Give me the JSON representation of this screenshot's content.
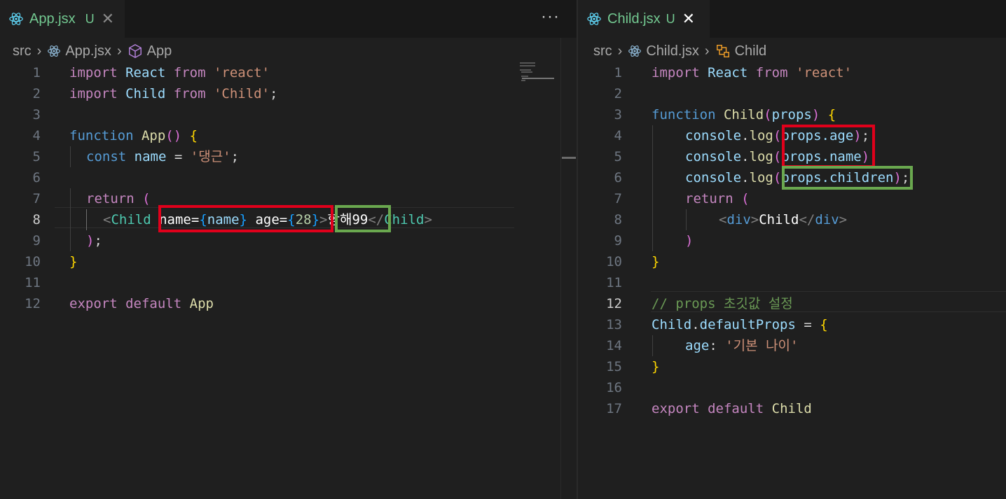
{
  "left_editor": {
    "tab": {
      "filename": "App.jsx",
      "status": "U",
      "close": "✕"
    },
    "more_actions": "···",
    "breadcrumb": {
      "folder": "src",
      "file": "App.jsx",
      "symbol": "App"
    },
    "lines": [
      {
        "n": "1"
      },
      {
        "n": "2"
      },
      {
        "n": "3"
      },
      {
        "n": "4"
      },
      {
        "n": "5"
      },
      {
        "n": "6"
      },
      {
        "n": "7"
      },
      {
        "n": "8"
      },
      {
        "n": "9"
      },
      {
        "n": "10"
      },
      {
        "n": "11"
      },
      {
        "n": "12"
      }
    ],
    "code": {
      "l1": {
        "import": "import",
        "name": "React",
        "from": "from",
        "src": "'react'"
      },
      "l2": {
        "import": "import",
        "name": "Child",
        "from": "from",
        "src": "'Child'",
        "semi": ";"
      },
      "l4": {
        "function": "function",
        "name": "App",
        "parens": "()",
        "brace": "{"
      },
      "l5": {
        "const": "const",
        "var": "name",
        "eq": "=",
        "value": "'댕근'",
        "semi": ";"
      },
      "l7": {
        "return": "return",
        "paren": "("
      },
      "l8": {
        "open": "<",
        "tag": "Child",
        "attr1": "name",
        "eq1": "=",
        "lb1": "{",
        "val1": "name",
        "rb1": "}",
        "attr2": "age",
        "eq2": "=",
        "lb2": "{",
        "val2": "28",
        "rb2": "}",
        "gt": ">",
        "text_kr": "항해",
        "text_num": "99",
        "close_open": "</",
        "close_tag": "Child",
        "close_gt": ">"
      },
      "l9": {
        "paren": ")",
        "semi": ";"
      },
      "l10": {
        "brace": "}"
      },
      "l12": {
        "export": "export",
        "default": "default",
        "name": "App"
      }
    },
    "current_line": "8"
  },
  "right_editor": {
    "tab": {
      "filename": "Child.jsx",
      "status": "U",
      "close": "✕"
    },
    "breadcrumb": {
      "folder": "src",
      "file": "Child.jsx",
      "symbol": "Child"
    },
    "lines": [
      {
        "n": "1"
      },
      {
        "n": "2"
      },
      {
        "n": "3"
      },
      {
        "n": "4"
      },
      {
        "n": "5"
      },
      {
        "n": "6"
      },
      {
        "n": "7"
      },
      {
        "n": "8"
      },
      {
        "n": "9"
      },
      {
        "n": "10"
      },
      {
        "n": "11"
      },
      {
        "n": "12"
      },
      {
        "n": "13"
      },
      {
        "n": "14"
      },
      {
        "n": "15"
      },
      {
        "n": "16"
      },
      {
        "n": "17"
      }
    ],
    "code": {
      "l1": {
        "import": "import",
        "name": "React",
        "from": "from",
        "src": "'react'"
      },
      "l3": {
        "function": "function",
        "name": "Child",
        "lp": "(",
        "param": "props",
        "rp": ")",
        "brace": "{"
      },
      "l4": {
        "obj": "console",
        "dot": ".",
        "method": "log",
        "lp": "(",
        "arg": "props.age",
        "rp": ")",
        "semi": ";"
      },
      "l5": {
        "obj": "console",
        "dot": ".",
        "method": "log",
        "lp": "(",
        "arg": "props.name",
        "rp": ")",
        "semi": ";"
      },
      "l6": {
        "obj": "console",
        "dot": ".",
        "method": "log",
        "lp": "(",
        "arg": "props.children",
        "rp": ")",
        "semi": ";"
      },
      "l7": {
        "return": "return",
        "paren": "("
      },
      "l8": {
        "open": "<",
        "tag": "div",
        "gt": ">",
        "text": "Child",
        "close_open": "</",
        "close_tag": "div",
        "close_gt": ">"
      },
      "l9": {
        "paren": ")"
      },
      "l10": {
        "brace": "}"
      },
      "l12": {
        "comment": "// props 초깃값 설정"
      },
      "l13": {
        "obj": "Child",
        "dot": ".",
        "prop": "defaultProps",
        "eq": "=",
        "brace": "{"
      },
      "l14": {
        "key": "age",
        "colon": ":",
        "value": "'기본 나이'"
      },
      "l15": {
        "brace": "}"
      },
      "l17": {
        "export": "export",
        "default": "default",
        "name": "Child"
      }
    },
    "current_line": "12"
  },
  "colors": {
    "background": "#1f1f1f",
    "tab_modified": "#73c991",
    "keyword": "#c586c0",
    "storage": "#569cd6",
    "function": "#dcdcaa",
    "variable": "#9cdcfe",
    "class": "#4ec9b0",
    "string": "#ce9178",
    "number": "#b5cea8",
    "comment": "#6a9955",
    "highlight_red": "#e0001b",
    "highlight_green": "#6aa84f"
  },
  "icons": {
    "react": "react-icon",
    "component": "cube-icon",
    "symbol": "symbol-icon",
    "chevron": "chevron-right-icon"
  }
}
